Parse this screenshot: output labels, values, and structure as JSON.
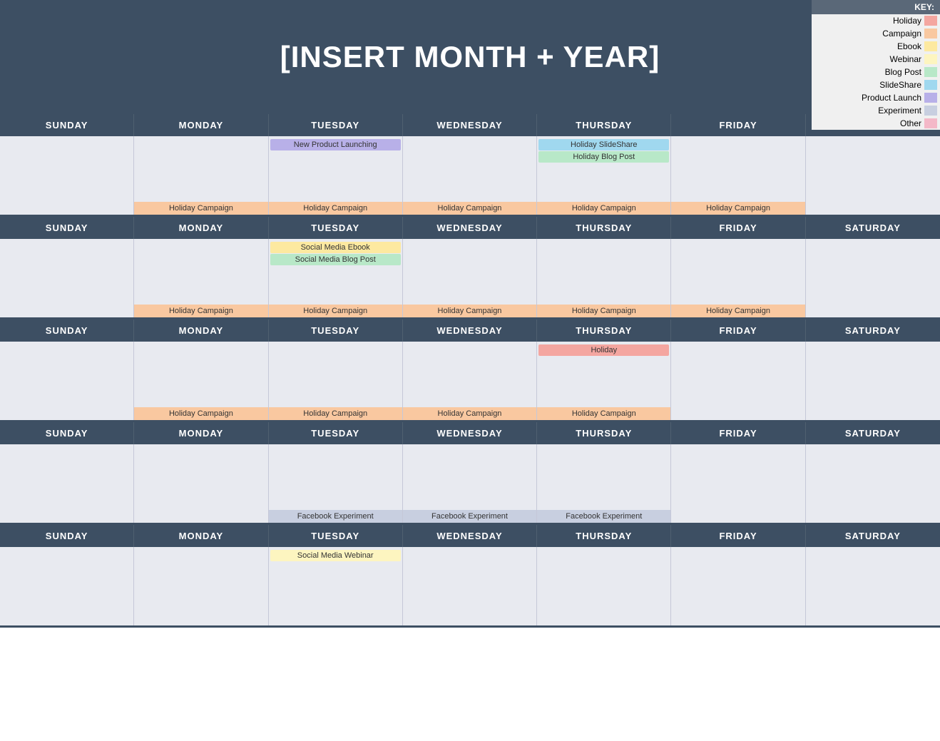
{
  "header": {
    "title": "[INSERT MONTH + YEAR]"
  },
  "key": {
    "label": "KEY:",
    "items": [
      {
        "name": "Holiday",
        "color": "#f4a6a0"
      },
      {
        "name": "Campaign",
        "color": "#f9c8a0"
      },
      {
        "name": "Ebook",
        "color": "#fde9a0"
      },
      {
        "name": "Webinar",
        "color": "#fdf5c0"
      },
      {
        "name": "Blog Post",
        "color": "#b8e8c8"
      },
      {
        "name": "SlideShare",
        "color": "#a0d8ef"
      },
      {
        "name": "Product Launch",
        "color": "#b8b0e8"
      },
      {
        "name": "Experiment",
        "color": "#c8cfe0"
      },
      {
        "name": "Other",
        "color": "#f4b8c8"
      }
    ]
  },
  "weekdays": [
    "SUNDAY",
    "MONDAY",
    "TUESDAY",
    "WEDNESDAY",
    "THURSDAY",
    "FRIDAY",
    "SATURDAY"
  ],
  "weeks": [
    {
      "days": [
        {
          "events": [],
          "bottom": ""
        },
        {
          "events": [],
          "bottom": "Holiday Campaign"
        },
        {
          "events": [
            "New Product Launching"
          ],
          "bottom": "Holiday Campaign"
        },
        {
          "events": [],
          "bottom": "Holiday Campaign"
        },
        {
          "events": [
            "Holiday SlideShare",
            "Holiday Blog Post"
          ],
          "bottom": "Holiday Campaign"
        },
        {
          "events": [],
          "bottom": "Holiday Campaign"
        },
        {
          "events": [],
          "bottom": ""
        }
      ]
    },
    {
      "days": [
        {
          "events": [],
          "bottom": ""
        },
        {
          "events": [],
          "bottom": "Holiday Campaign"
        },
        {
          "events": [
            "Social Media Ebook",
            "Social Media Blog Post"
          ],
          "bottom": "Holiday Campaign"
        },
        {
          "events": [],
          "bottom": "Holiday Campaign"
        },
        {
          "events": [],
          "bottom": "Holiday Campaign"
        },
        {
          "events": [],
          "bottom": "Holiday Campaign"
        },
        {
          "events": [],
          "bottom": ""
        }
      ]
    },
    {
      "days": [
        {
          "events": [],
          "bottom": ""
        },
        {
          "events": [],
          "bottom": "Holiday Campaign"
        },
        {
          "events": [],
          "bottom": "Holiday Campaign"
        },
        {
          "events": [],
          "bottom": "Holiday Campaign"
        },
        {
          "events": [
            "Holiday"
          ],
          "bottom": "Holiday Campaign"
        },
        {
          "events": [],
          "bottom": ""
        },
        {
          "events": [],
          "bottom": ""
        }
      ]
    },
    {
      "days": [
        {
          "events": [],
          "bottom": ""
        },
        {
          "events": [],
          "bottom": ""
        },
        {
          "events": [],
          "bottom": "Facebook Experiment"
        },
        {
          "events": [],
          "bottom": "Facebook Experiment"
        },
        {
          "events": [],
          "bottom": "Facebook Experiment"
        },
        {
          "events": [],
          "bottom": ""
        },
        {
          "events": [],
          "bottom": ""
        }
      ]
    },
    {
      "days": [
        {
          "events": [],
          "bottom": ""
        },
        {
          "events": [],
          "bottom": ""
        },
        {
          "events": [
            "Social Media Webinar"
          ],
          "bottom": ""
        },
        {
          "events": [],
          "bottom": ""
        },
        {
          "events": [],
          "bottom": ""
        },
        {
          "events": [],
          "bottom": ""
        },
        {
          "events": [],
          "bottom": ""
        }
      ]
    }
  ]
}
